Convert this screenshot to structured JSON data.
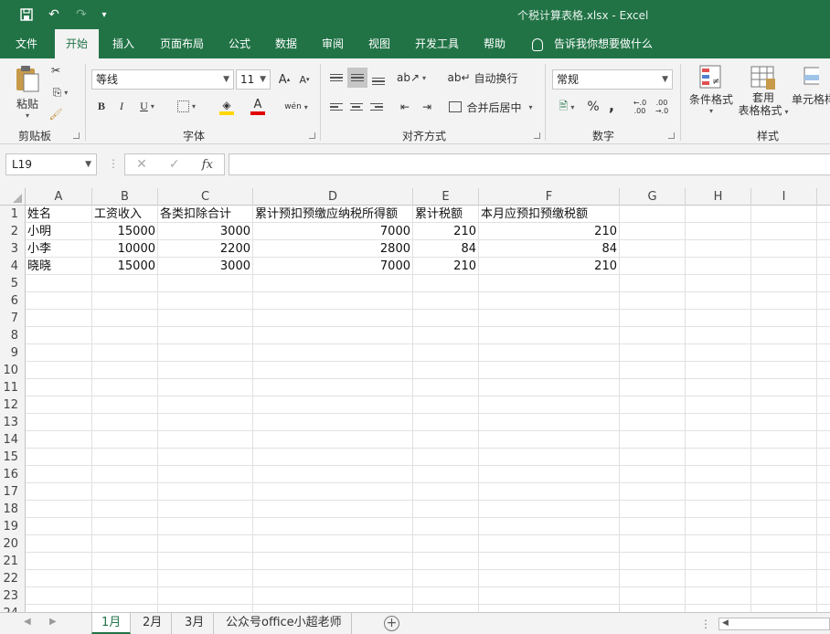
{
  "window": {
    "title": "个税计算表格.xlsx  -  Excel",
    "qat": {
      "save": "🖫",
      "undo": "↶",
      "redo": "↷",
      "customize": "▾"
    }
  },
  "tabs": [
    "文件",
    "开始",
    "插入",
    "页面布局",
    "公式",
    "数据",
    "审阅",
    "视图",
    "开发工具",
    "帮助"
  ],
  "active_tab": "开始",
  "tell_me": "告诉我你想要做什么",
  "ribbon": {
    "clipboard": {
      "label": "剪贴板",
      "paste": "粘贴"
    },
    "font": {
      "label": "字体",
      "name": "等线",
      "size": "11",
      "bold": "B",
      "italic": "I",
      "underline": "U",
      "grow": "A",
      "shrink": "A",
      "fill_color": "#ffd700",
      "font_color": "#e00000",
      "phonetic": "wén"
    },
    "alignment": {
      "label": "对齐方式",
      "wrap": "自动换行",
      "merge": "合并后居中"
    },
    "number": {
      "label": "数字",
      "format": "常规",
      "percent": "%",
      "comma": ","
    },
    "styles": {
      "label": "样式",
      "conditional": "条件格式",
      "table_line1": "套用",
      "table_line2": "表格格式",
      "cell": "单元格样"
    }
  },
  "formula_bar": {
    "name_box": "L19",
    "cancel": "✕",
    "enter": "✓",
    "fx": "fx",
    "formula": ""
  },
  "sheet": {
    "columns": [
      "A",
      "B",
      "C",
      "D",
      "E",
      "F",
      "G",
      "H",
      "I"
    ],
    "rows": [
      [
        "姓名",
        "工资收入",
        "各类扣除合计",
        "累计预扣预缴应纳税所得额",
        "累计税额",
        "本月应预扣预缴税额"
      ],
      [
        "小明",
        "15000",
        "3000",
        "7000",
        "210",
        "210"
      ],
      [
        "小李",
        "10000",
        "2200",
        "2800",
        "84",
        "84"
      ],
      [
        "晓晓",
        "15000",
        "3000",
        "7000",
        "210",
        "210"
      ]
    ],
    "row_numbers": [
      "1",
      "2",
      "3",
      "4",
      "5",
      "6",
      "7",
      "8",
      "9",
      "10",
      "11",
      "12",
      "13",
      "14",
      "15",
      "16",
      "17",
      "18",
      "19",
      "20",
      "21",
      "22",
      "23",
      "24"
    ]
  },
  "sheet_tabs": [
    "1月",
    "2月",
    "3月",
    "公众号office小超老师"
  ],
  "active_sheet": "1月",
  "colors": {
    "accent": "#217346",
    "ribbon_bg": "#f3f3f3"
  }
}
